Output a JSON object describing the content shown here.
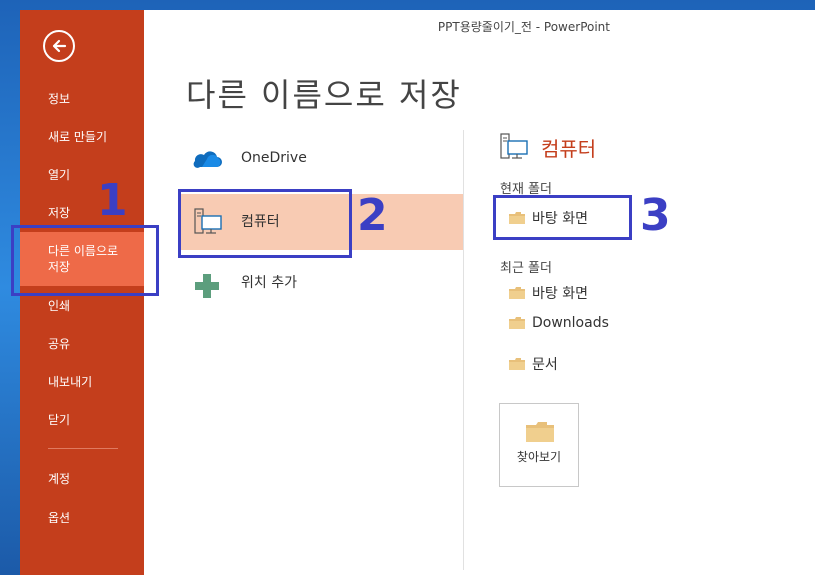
{
  "window": {
    "title": "PPT용량줄이기_전 - PowerPoint"
  },
  "sidebar": {
    "items": [
      {
        "label": "정보"
      },
      {
        "label": "새로 만들기"
      },
      {
        "label": "열기"
      },
      {
        "label": "저장"
      },
      {
        "label": "다른 이름으로\n저장",
        "selected": true
      },
      {
        "label": "인쇄"
      },
      {
        "label": "공유"
      },
      {
        "label": "내보내기"
      },
      {
        "label": "닫기"
      },
      {
        "label": "계정"
      },
      {
        "label": "옵션"
      }
    ]
  },
  "page_title": "다른 이름으로 저장",
  "locations": [
    {
      "label": "OneDrive",
      "icon": "onedrive-cloud-icon"
    },
    {
      "label": "컴퓨터",
      "icon": "computer-icon",
      "selected": true
    },
    {
      "label": "위치 추가",
      "icon": "plus-icon"
    }
  ],
  "right_panel": {
    "heading": "컴퓨터",
    "current_folder_label": "현재 폴더",
    "current_folder": "바탕 화면",
    "recent_folders_label": "최근 폴더",
    "recent_folders": [
      "바탕 화면",
      "Downloads",
      "문서"
    ],
    "browse_label": "찾아보기"
  },
  "annotations": [
    "1",
    "2",
    "3"
  ],
  "colors": {
    "sidebar": "#c43e1c",
    "sidebar_selected": "#ee6a48",
    "location_selected": "#f8cbb3",
    "annotation": "#3b3fc4"
  }
}
